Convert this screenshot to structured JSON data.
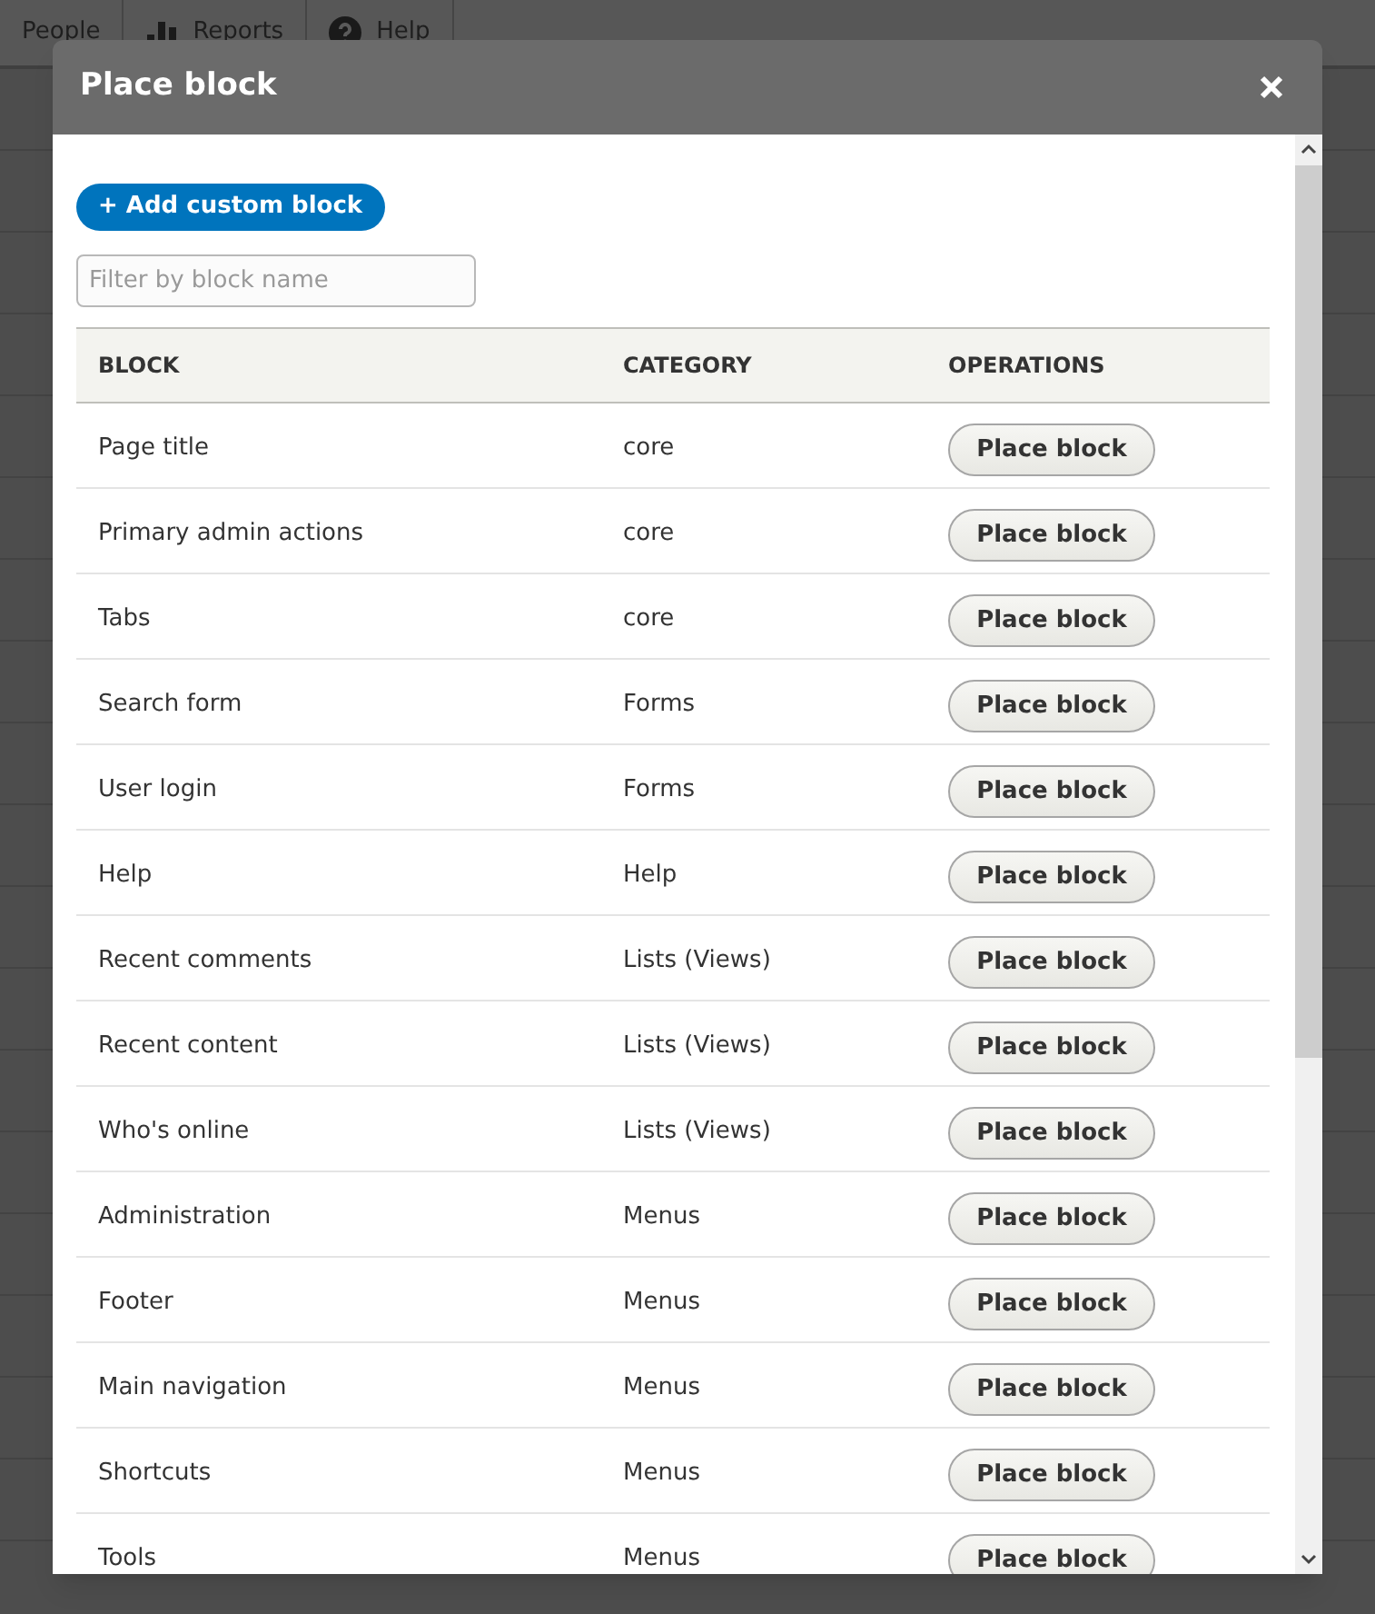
{
  "toolbar": {
    "items": [
      {
        "label": "People",
        "kind": "plain"
      },
      {
        "label": "Reports",
        "kind": "chart"
      },
      {
        "label": "Help",
        "kind": "help"
      }
    ]
  },
  "dialog": {
    "title": "Place block",
    "add_button": "+ Add custom block",
    "filter": {
      "placeholder": "Filter by block name"
    },
    "table": {
      "columns": [
        "BLOCK",
        "CATEGORY",
        "OPERATIONS"
      ],
      "rows": [
        {
          "block": "Page title",
          "category": "core",
          "operation": "Place block"
        },
        {
          "block": "Primary admin actions",
          "category": "core",
          "operation": "Place block"
        },
        {
          "block": "Tabs",
          "category": "core",
          "operation": "Place block"
        },
        {
          "block": "Search form",
          "category": "Forms",
          "operation": "Place block"
        },
        {
          "block": "User login",
          "category": "Forms",
          "operation": "Place block"
        },
        {
          "block": "Help",
          "category": "Help",
          "operation": "Place block"
        },
        {
          "block": "Recent comments",
          "category": "Lists (Views)",
          "operation": "Place block"
        },
        {
          "block": "Recent content",
          "category": "Lists (Views)",
          "operation": "Place block"
        },
        {
          "block": "Who's online",
          "category": "Lists (Views)",
          "operation": "Place block"
        },
        {
          "block": "Administration",
          "category": "Menus",
          "operation": "Place block"
        },
        {
          "block": "Footer",
          "category": "Menus",
          "operation": "Place block"
        },
        {
          "block": "Main navigation",
          "category": "Menus",
          "operation": "Place block"
        },
        {
          "block": "Shortcuts",
          "category": "Menus",
          "operation": "Place block"
        },
        {
          "block": "Tools",
          "category": "Menus",
          "operation": "Place block"
        }
      ]
    }
  }
}
